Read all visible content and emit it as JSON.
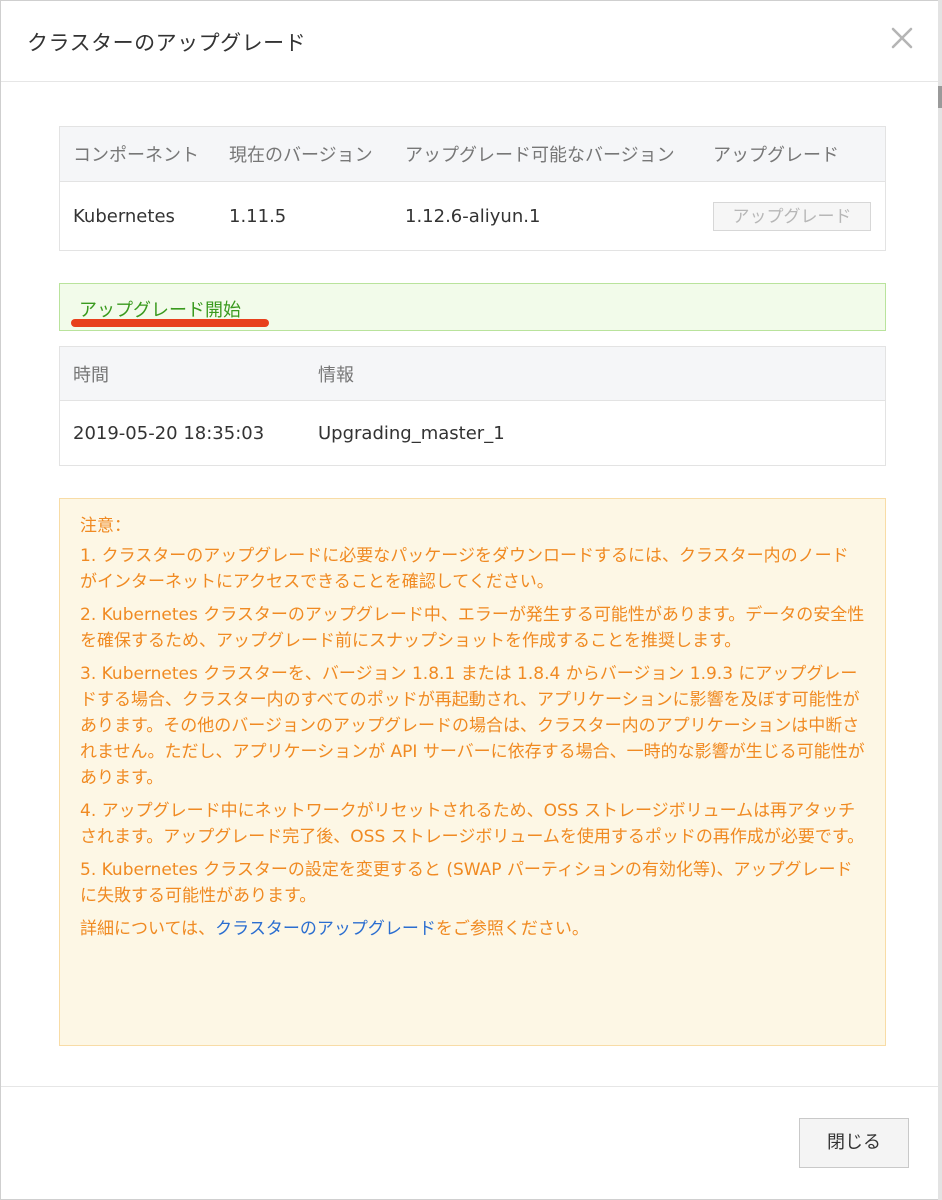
{
  "dialog": {
    "title": "クラスターのアップグレード",
    "close_icon": "close-icon"
  },
  "upgrade_table": {
    "headers": [
      "コンポーネント",
      "現在のバージョン",
      "アップグレード可能なバージョン",
      "アップグレード"
    ],
    "rows": [
      {
        "component": "Kubernetes",
        "current_version": "1.11.5",
        "available_version": "1.12.6-aliyun.1",
        "button_label": "アップグレード"
      }
    ]
  },
  "status": {
    "message": "アップグレード開始",
    "color": "#3a9a1e",
    "highlight_color": "#e8401c"
  },
  "log_table": {
    "headers": [
      "時間",
      "情報"
    ],
    "rows": [
      {
        "time": "2019-05-20 18:35:03",
        "info": "Upgrading_master_1"
      }
    ]
  },
  "notice": {
    "heading": "注意：",
    "items": [
      "1. クラスターのアップグレードに必要なパッケージをダウンロードするには、クラスター内のノードがインターネットにアクセスできることを確認してください。",
      "2. Kubernetes クラスターのアップグレード中、エラーが発生する可能性があります。データの安全性を確保するため、アップグレード前にスナップショットを作成することを推奨します。",
      "3. Kubernetes クラスターを、バージョン 1.8.1 または 1.8.4 からバージョン 1.9.3 にアップグレードする場合、クラスター内のすべてのポッドが再起動され、アプリケーションに影響を及ぼす可能性があります。その他のバージョンのアップグレードの場合は、クラスター内のアプリケーションは中断されません。ただし、アプリケーションが API サーバーに依存する場合、一時的な影響が生じる可能性があります。",
      "4. アップグレード中にネットワークがリセットされるため、OSS ストレージボリュームは再アタッチされます。アップグレード完了後、OSS ストレージボリュームを使用するポッドの再作成が必要です。",
      "5. Kubernetes クラスターの設定を変更すると (SWAP パーティションの有効化等)、アップグレードに失敗する可能性があります。"
    ],
    "details_prefix": "詳細については、",
    "details_link": "クラスターのアップグレード",
    "details_suffix": "をご参照ください。",
    "text_color": "#f08a22",
    "link_color": "#2b6ed0"
  },
  "footer": {
    "close_button_label": "閉じる"
  }
}
